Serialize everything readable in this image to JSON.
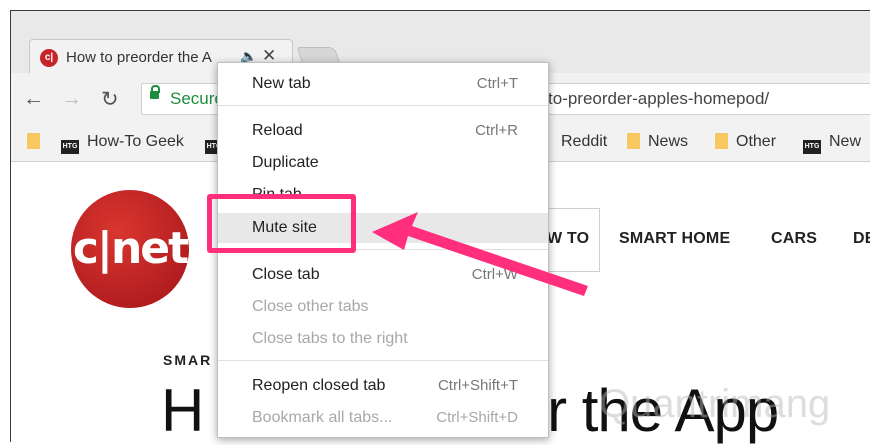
{
  "tab": {
    "favicon_text": "c|",
    "title": "How to preorder the A",
    "audio_icon": "speaker-icon",
    "close_icon": "close-icon"
  },
  "toolbar": {
    "back_icon": "back-arrow-icon",
    "forward_icon": "forward-arrow-icon",
    "reload_icon": "reload-icon",
    "secure_label": "Secure",
    "url_visible": "to-preorder-apples-homepod/"
  },
  "bookmarks": [
    {
      "label": "",
      "icon": "folder-icon"
    },
    {
      "label": "How-To Geek",
      "icon": "htg-icon"
    },
    {
      "label": "Reddit",
      "icon": "reddit-icon"
    },
    {
      "label": "News",
      "icon": "folder-icon"
    },
    {
      "label": "Other",
      "icon": "folder-icon"
    },
    {
      "label": "New",
      "icon": "htg-icon"
    }
  ],
  "bookmark_icon_text": "HTG",
  "page": {
    "logo_text": "c|net",
    "nav": [
      "W TO",
      "SMART HOME",
      "CARS",
      "DE"
    ],
    "section_label": "SMAR",
    "headline_left": "H",
    "headline_right": "rder the App",
    "watermark": "Quantrimang"
  },
  "menu": {
    "items": [
      {
        "label": "New tab",
        "shortcut": "Ctrl+T",
        "disabled": false
      },
      {
        "label": "Reload",
        "shortcut": "Ctrl+R",
        "disabled": false
      },
      {
        "label": "Duplicate",
        "shortcut": "",
        "disabled": false
      },
      {
        "label": "Pin tab",
        "shortcut": "",
        "disabled": false
      },
      {
        "label": "Mute site",
        "shortcut": "",
        "disabled": false
      },
      {
        "label": "Close tab",
        "shortcut": "Ctrl+W",
        "disabled": false
      },
      {
        "label": "Close other tabs",
        "shortcut": "",
        "disabled": true
      },
      {
        "label": "Close tabs to the right",
        "shortcut": "",
        "disabled": true
      },
      {
        "label": "Reopen closed tab",
        "shortcut": "Ctrl+Shift+T",
        "disabled": false
      },
      {
        "label": "Bookmark all tabs...",
        "shortcut": "Ctrl+Shift+D",
        "disabled": true
      }
    ]
  },
  "colors": {
    "annotation": "#ff2f7d",
    "cnet_red": "#c6242b",
    "secure_green": "#1e8e3e"
  }
}
